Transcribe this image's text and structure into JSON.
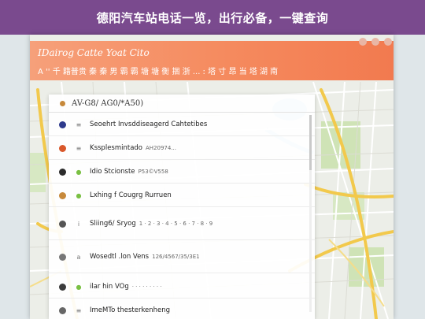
{
  "banner": {
    "title": "德阳汽车站电话一览，出行必备，一键查询"
  },
  "app": {
    "header_title": "IDairog Catte Yoat Cito",
    "header_subtitle": "A  '' 千 籍普贵 秦 秦 男 霸 霸 塘 塘 衡 捆 浙 ...  :   塔 寸 昂 当 塔 湖 南"
  },
  "panel": {
    "title": "AV-G8/ AG0/*A50)",
    "stations": [
      {
        "name": "Seoehrt Invsddiseagerd Cahtetibes",
        "phone": "",
        "lead_color": "#2e3a8c",
        "mark": "≡"
      },
      {
        "name": "Kssplesmintado",
        "phone": "AH20974...",
        "lead_color": "#d9582b",
        "mark": "≡"
      },
      {
        "name": "Idio Stcionste",
        "phone": "P53©V558",
        "lead_color": "#2b2b2b",
        "mark": "●"
      },
      {
        "name": "Lxhing f Cougrg Rurruen",
        "phone": "",
        "lead_color": "#c7893b",
        "mark": "●"
      },
      {
        "name": "Sliing6/ Sryog",
        "phone": "1 · 2 · 3 · 4 · 5 · 6 · 7 · 8 · 9",
        "lead_color": "#555555",
        "mark": "i"
      },
      {
        "name": "Wosedtl .lon Vens",
        "phone": "126/4567/35/3E1",
        "lead_color": "#777777",
        "mark": "a"
      },
      {
        "name": "ilar hin VOg",
        "phone": "· · · · · · · · ·",
        "lead_color": "#3b3b3b",
        "mark": "●"
      },
      {
        "name": "ImeMTo thesterkenheng",
        "phone": "",
        "lead_color": "#666666",
        "mark": "≡"
      }
    ]
  },
  "colors": {
    "banner": "#7a4a8e",
    "header": "#f58a5e",
    "road": "#f2c94c",
    "water": "#a7d7e8",
    "park": "#cfe3b6"
  }
}
